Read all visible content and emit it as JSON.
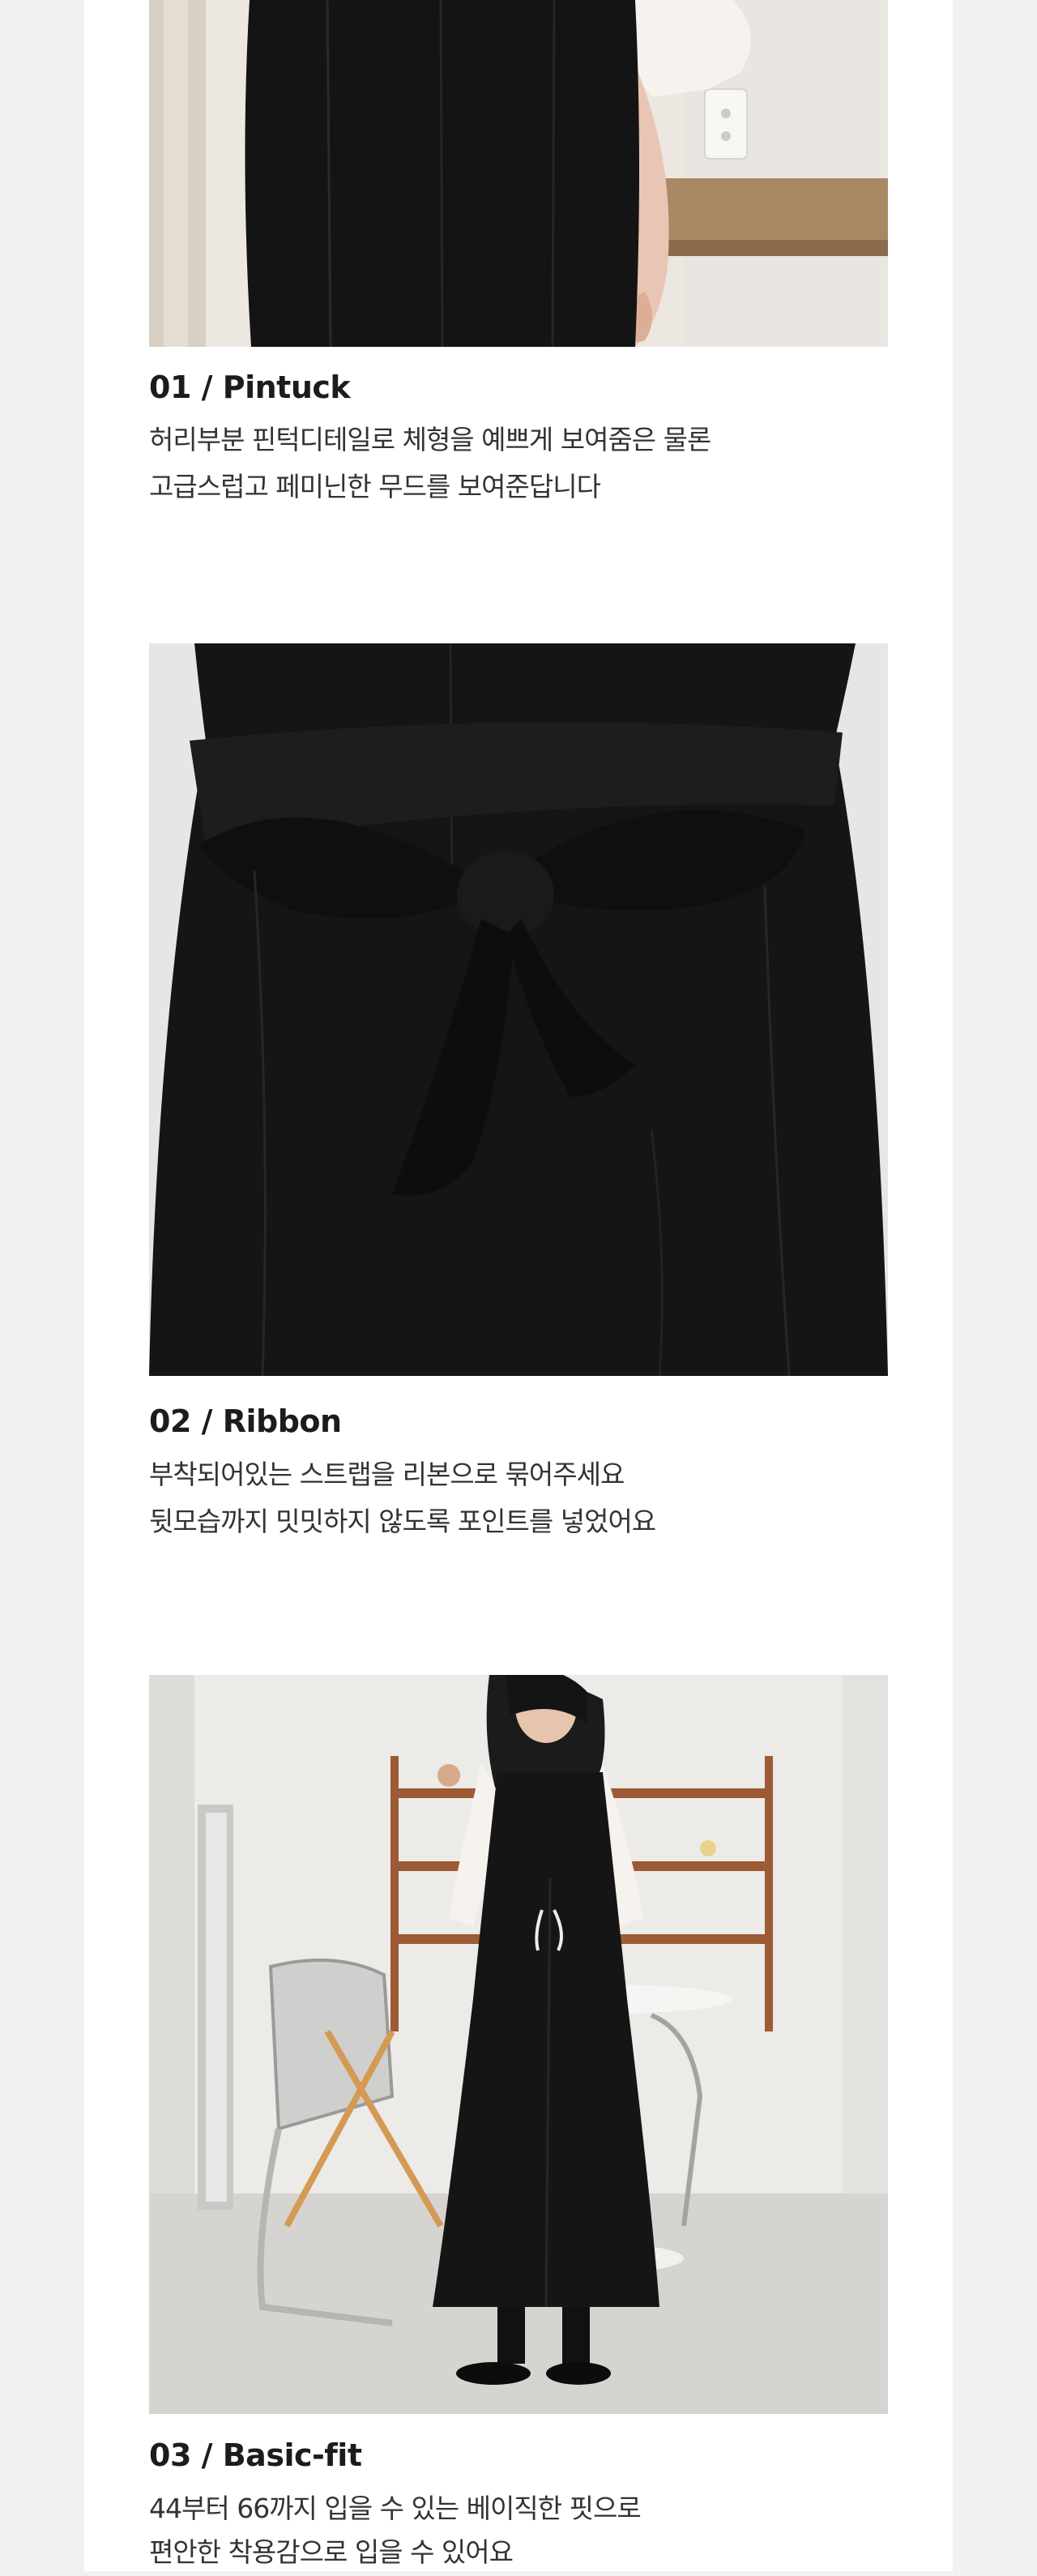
{
  "sections": [
    {
      "title": "01 / Pintuck",
      "lines": [
        "허리부분 핀턱디테일로 체형을 예쁘게 보여줌은 물론",
        "고급스럽고 페미닌한 무드를 보여준답니다"
      ]
    },
    {
      "title": "02 / Ribbon",
      "lines": [
        "부착되어있는 스트랩을 리본으로 묶어주세요",
        "뒷모습까지 밋밋하지 않도록 포인트를 넣었어요"
      ]
    },
    {
      "title": "03 / Basic-fit",
      "lines": [
        "44부터 66까지 입을 수 있는 베이직한 핏으로",
        "편안한 착용감으로 입을 수 있어요"
      ]
    }
  ],
  "colors": {
    "page_bg": "#f1f1f1",
    "content_bg": "#ffffff",
    "title_text": "#1c1c1c",
    "body_text": "#333333",
    "dress_black": "#141414"
  }
}
